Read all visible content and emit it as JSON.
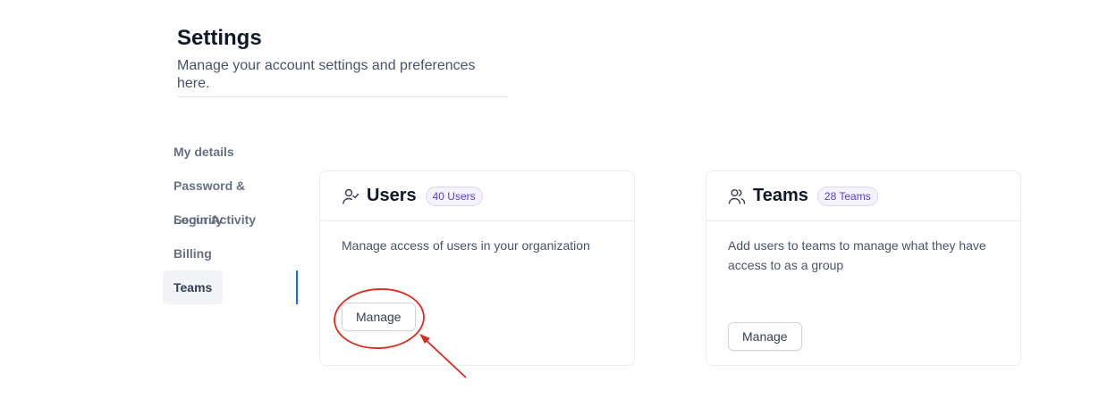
{
  "header": {
    "title": "Settings",
    "subtitle": "Manage your account settings and preferences here."
  },
  "sidebar": {
    "items": [
      {
        "label": "My details",
        "active": false
      },
      {
        "label": "Password & Security",
        "active": false
      },
      {
        "label": "Login Activity",
        "active": false
      },
      {
        "label": "Billing",
        "active": false
      },
      {
        "label": "Teams",
        "active": true
      }
    ]
  },
  "cards": {
    "users": {
      "icon": "user-check-icon",
      "title": "Users",
      "badge": "40 Users",
      "description": "Manage access of users in your organization",
      "button_label": "Manage"
    },
    "teams": {
      "icon": "users-icon",
      "title": "Teams",
      "badge": "28 Teams",
      "description": "Add users to teams to manage what they have access to as a group",
      "button_label": "Manage"
    }
  },
  "colors": {
    "accent": "#1570ef",
    "badge_text": "#5b3fc4",
    "annotation": "#d92d20"
  }
}
